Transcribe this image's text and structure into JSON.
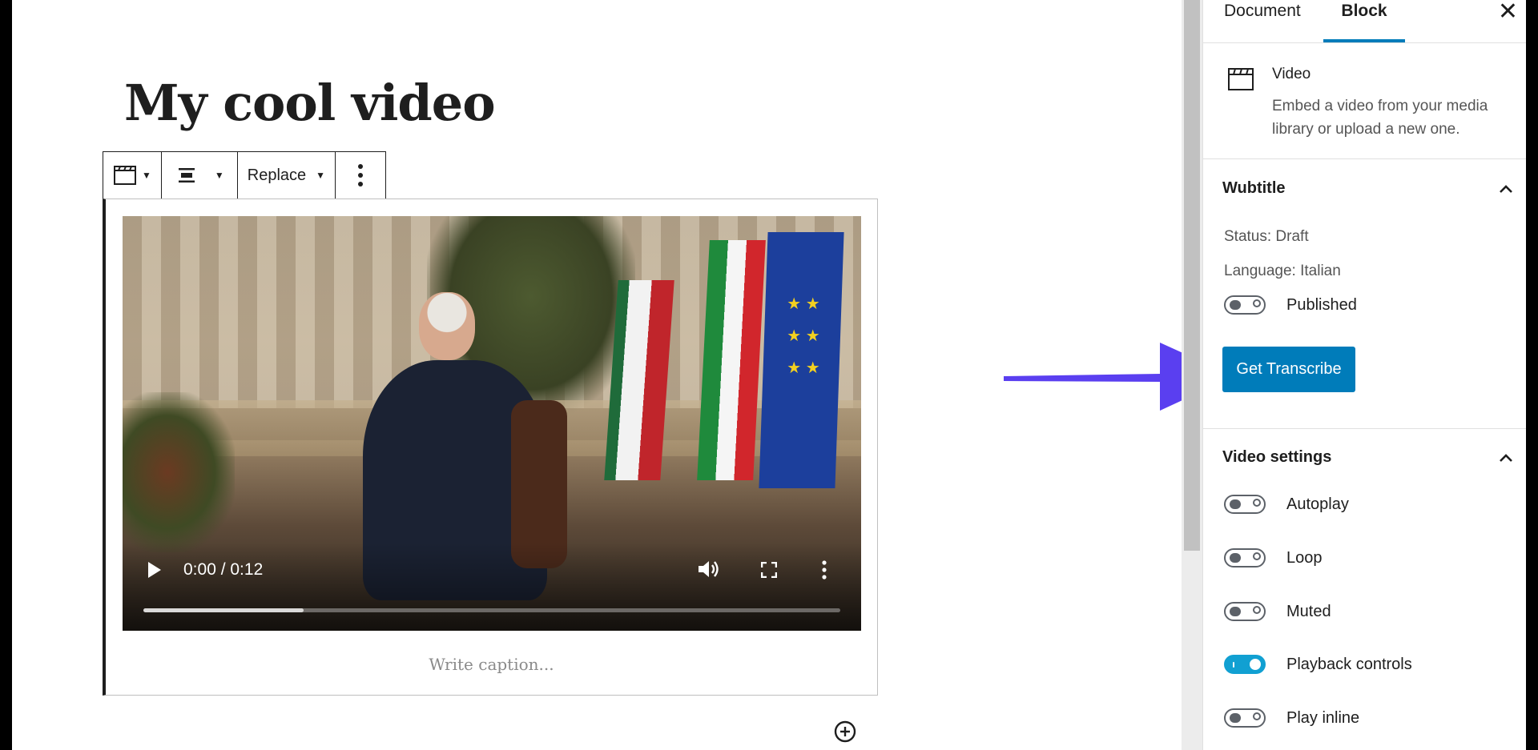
{
  "editor": {
    "post_title": "My cool video",
    "toolbar": {
      "replace_label": "Replace"
    },
    "video": {
      "time": "0:00 / 0:12",
      "progress": 0.23,
      "caption_placeholder": "Write caption..."
    }
  },
  "sidebar": {
    "tabs": {
      "document": "Document",
      "block": "Block"
    },
    "close_icon": "close-icon",
    "block_card": {
      "icon": "video-icon",
      "name": "Video",
      "description": "Embed a video from your media library or upload a new one."
    },
    "subtitle_panel": {
      "title": "Wubtitle",
      "status": "Status: Draft",
      "language": "Language: Italian",
      "published_label": "Published",
      "published": false,
      "button_label": "Get Transcribe"
    },
    "video_settings": {
      "title": "Video settings",
      "options": [
        {
          "label": "Autoplay",
          "on": false
        },
        {
          "label": "Loop",
          "on": false
        },
        {
          "label": "Muted",
          "on": false
        },
        {
          "label": "Playback controls",
          "on": true
        },
        {
          "label": "Play inline",
          "on": false
        }
      ]
    }
  },
  "colors": {
    "accent": "#007cba",
    "toggle_on": "#11a0d2",
    "arrow": "#5a3ff0"
  }
}
